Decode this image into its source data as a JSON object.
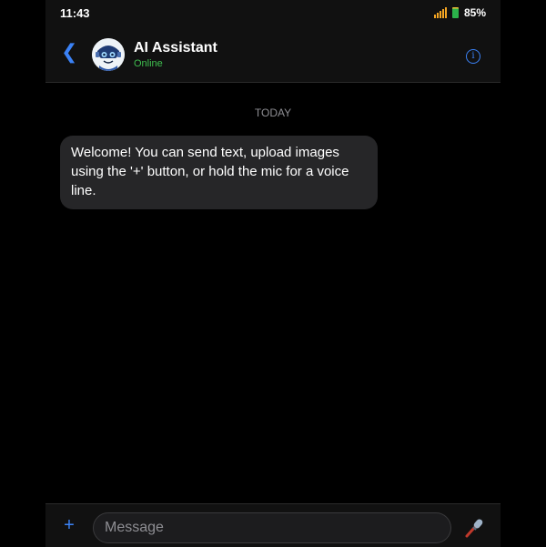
{
  "status_bar": {
    "time": "11:43",
    "battery_percent": "85%",
    "icons": [
      "wifi-signal-icon",
      "battery-icon"
    ]
  },
  "header": {
    "name": "AI Assistant",
    "status": "Online",
    "back_icon": "chevron-left-icon",
    "info_icon": "info-icon",
    "avatar": "robot-avatar"
  },
  "conversation": {
    "date_divider": "TODAY",
    "messages": [
      {
        "sender": "assistant",
        "text": "Welcome! You can send text, upload images using the '+' button, or hold the mic for a voice line."
      }
    ]
  },
  "composer": {
    "placeholder": "Message",
    "value": "",
    "attach_icon": "plus-icon",
    "mic_icon": "microphone-icon"
  },
  "colors": {
    "accent": "#3b82f6",
    "online": "#3fbf4f",
    "bubble": "#262628",
    "background": "#000000",
    "bar": "#111111"
  }
}
